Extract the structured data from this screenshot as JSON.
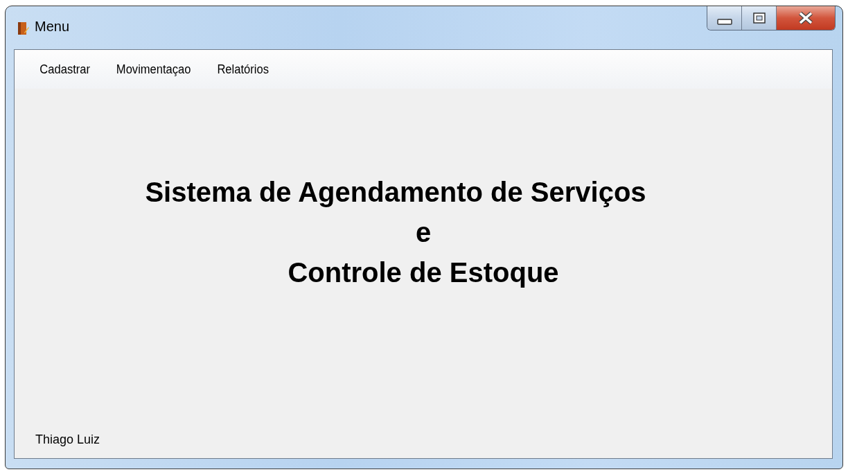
{
  "window": {
    "title": "Menu"
  },
  "menu": [
    {
      "label": "Cadastrar"
    },
    {
      "label": "Movimentaçao"
    },
    {
      "label": "Relatórios"
    }
  ],
  "heading": [
    "Sistema de Agendamento de Serviços",
    "e",
    "Controle de Estoque"
  ],
  "footer": "Thiago Luiz"
}
